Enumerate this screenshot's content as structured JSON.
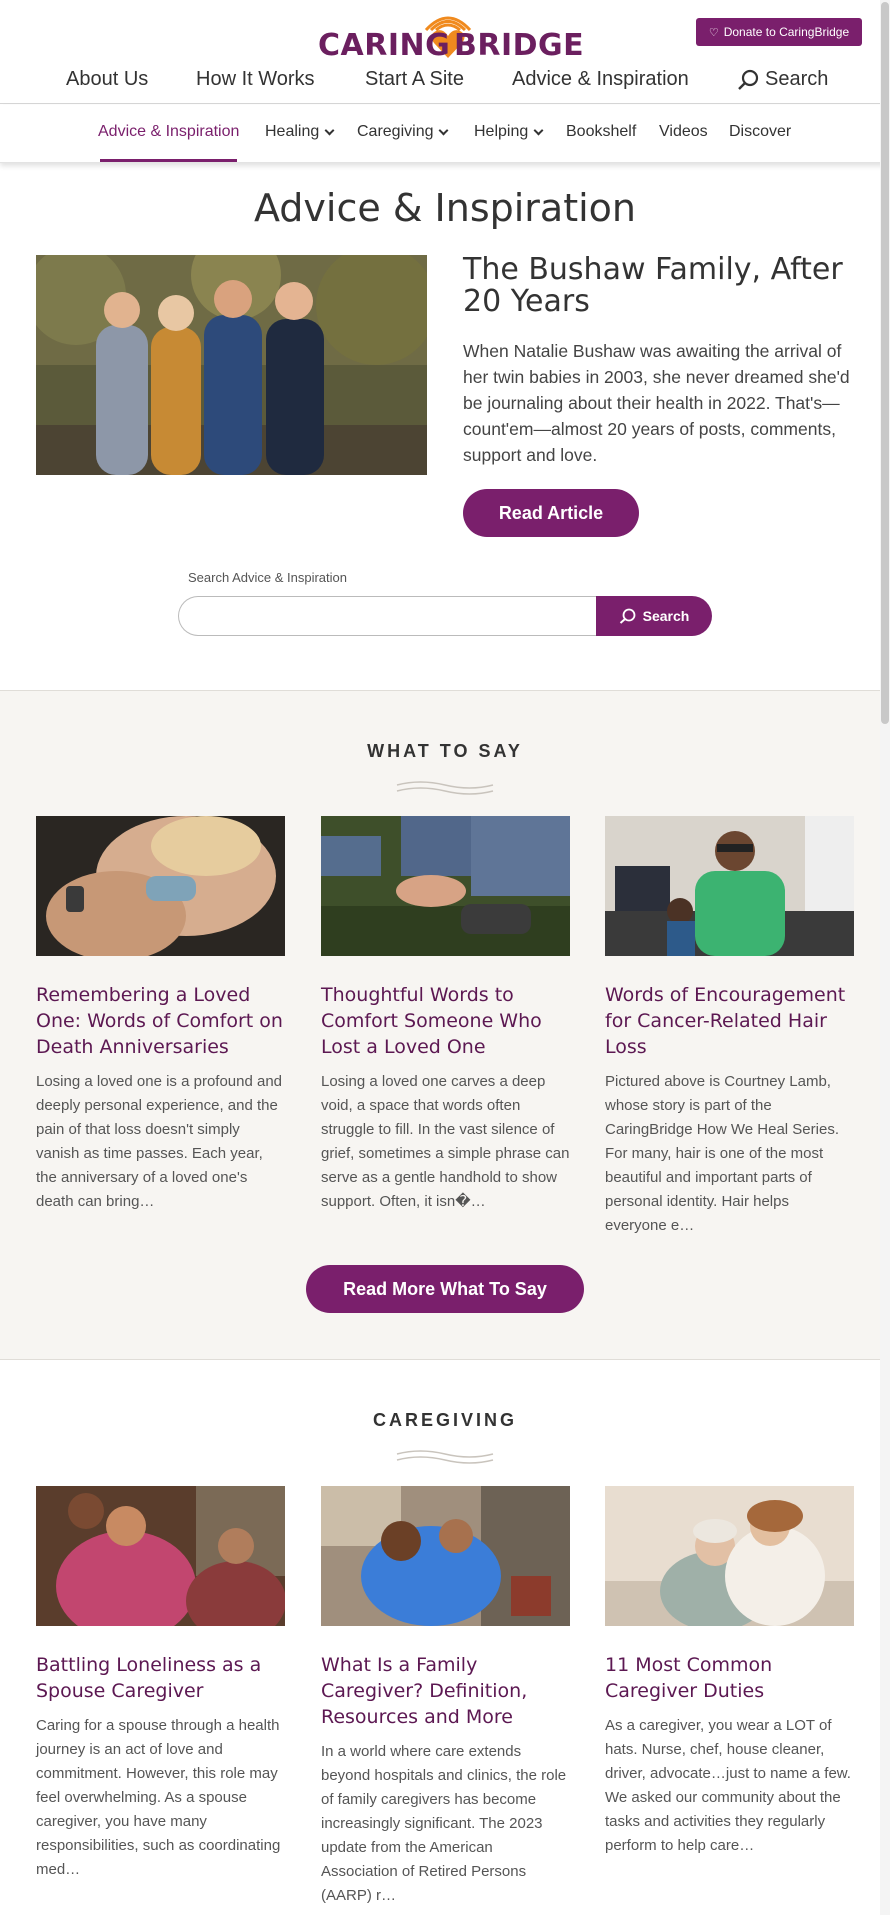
{
  "header": {
    "logo_left": "CARING",
    "logo_right": "BRIDGE",
    "donate_label": "Donate to CaringBridge",
    "nav": [
      "About Us",
      "How It Works",
      "Start A Site",
      "Advice & Inspiration"
    ],
    "search_label": "Search"
  },
  "subnav": {
    "items": [
      "Advice & Inspiration",
      "Healing",
      "Caregiving",
      "Helping",
      "Bookshelf",
      "Videos",
      "Discover"
    ]
  },
  "page_title": "Advice & Inspiration",
  "hero": {
    "title": "The Bushaw Family, After 20 Years",
    "description": "When Natalie Bushaw was awaiting the arrival of her twin babies in 2003, she never dreamed she'd be journaling about their health in 2022. That's—count'em—almost 20 years of posts, comments, support and love.",
    "button": "Read Article"
  },
  "search": {
    "label": "Search Advice & Inspiration",
    "placeholder": "",
    "button": "Search"
  },
  "what_to_say": {
    "title": "WHAT TO SAY",
    "cards": [
      {
        "title": "Remembering a Loved One: Words of Comfort on Death Anniversaries",
        "desc": "Losing a loved one is a profound and deeply personal experience, and the pain of that loss doesn't simply vanish as time passes. Each year, the anniversary of a loved one's death can bring…"
      },
      {
        "title": "Thoughtful Words to Comfort Someone Who Lost a Loved One",
        "desc": "Losing a loved one carves a deep void, a space that words often struggle to fill. In the vast silence of grief, sometimes a simple phrase can serve as a gentle handhold to show support. Often, it isn�…"
      },
      {
        "title": "Words of Encouragement for Cancer-Related Hair Loss",
        "desc": "Pictured above is Courtney Lamb, whose story is part of the CaringBridge How We Heal Series. For many, hair is one of the most beautiful and important parts of personal identity. Hair helps everyone e…"
      }
    ],
    "button": "Read More What To Say"
  },
  "caregiving": {
    "title": "CAREGIVING",
    "cards": [
      {
        "title": "Battling Loneliness as a Spouse Caregiver",
        "desc": "Caring for a spouse through a health journey is an act of love and commitment. However, this role may feel overwhelming. As a spouse caregiver, you have many responsibilities, such as coordinating med…"
      },
      {
        "title": "What Is a Family Caregiver? Definition, Resources and More",
        "desc": "In a world where care extends beyond hospitals and clinics, the role of family caregivers has become increasingly significant. The 2023 update from the American Association of Retired Persons (AARP) r…"
      },
      {
        "title": "11 Most Common Caregiver Duties",
        "desc": "As a caregiver, you wear a LOT of hats. Nurse, chef, house cleaner, driver, advocate…just to name a few. We asked our community about the tasks and activities they regularly perform to help care…"
      }
    ]
  },
  "colors": {
    "brand_purple": "#7a1f6c",
    "title_purple": "#5c1852",
    "logo_orange": "#f08a1e",
    "section_bg": "#f7f5f2"
  },
  "icons": {
    "search": "search-icon",
    "heart": "heart-icon",
    "chevron": "chevron-down-icon"
  }
}
